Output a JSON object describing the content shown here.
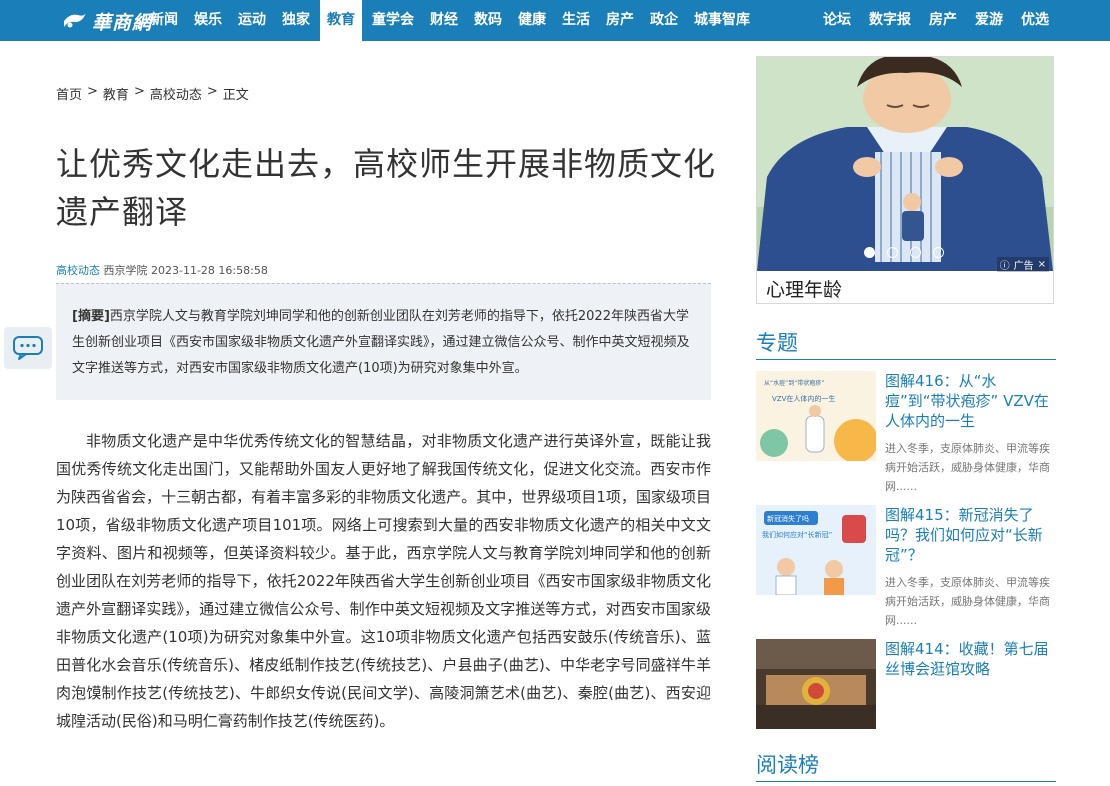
{
  "nav": {
    "logo_text": "華商網",
    "items": [
      "新闻",
      "娱乐",
      "运动",
      "独家",
      "教育",
      "童学会",
      "财经",
      "数码",
      "健康",
      "生活",
      "房产",
      "政企",
      "城事智库"
    ],
    "active": "教育",
    "right_items": [
      "论坛",
      "数字报",
      "房产",
      "爱游",
      "优选"
    ]
  },
  "breadcrumb": [
    "首页",
    "教育",
    "高校动态",
    "正文"
  ],
  "breadcrumb_sep": ">",
  "article": {
    "title": "让优秀文化走出去，高校师生开展非物质文化遗产翻译",
    "category": "高校动态",
    "source": "西京学院",
    "datetime": "2023-11-28 16:58:58",
    "abstract_label": "[摘要]",
    "abstract_text": "西京学院人文与教育学院刘坤同学和他的创新创业团队在刘芳老师的指导下，依托2022年陕西省大学生创新创业项目《西安市国家级非物质文化遗产外宣翻译实践》，通过建立微信公众号、制作中英文短视频及文字推送等方式，对西安市国家级非物质文化遗产(10项)为研究对象集中外宣。",
    "body": "非物质文化遗产是中华优秀传统文化的智慧结晶，对非物质文化遗产进行英译外宣，既能让我国优秀传统文化走出国门，又能帮助外国友人更好地了解我国传统文化，促进文化交流。西安市作为陕西省省会，十三朝古都，有着丰富多彩的非物质文化遗产。其中，世界级项目1项，国家级项目10项，省级非物质文化遗产项目101项。网络上可搜索到大量的西安非物质文化遗产的相关中文文字资料、图片和视频等，但英译资料较少。基于此，西京学院人文与教育学院刘坤同学和他的创新创业团队在刘芳老师的指导下，依托2022年陕西省大学生创新创业项目《西安市国家级非物质文化遗产外宣翻译实践》，通过建立微信公众号、制作中英文短视频及文字推送等方式，对西安市国家级非物质文化遗产(10项)为研究对象集中外宣。这10项非物质文化遗产包括西安鼓乐(传统音乐)、蓝田普化水会音乐(传统音乐)、楮皮纸制作技艺(传统技艺)、户县曲子(曲艺)、中华老字号同盛祥牛羊肉泡馍制作技艺(传统技艺)、牛郎织女传说(民间文学)、高陵洞箫艺术(曲艺)、秦腔(曲艺)、西安迎城隍活动(民俗)和马明仁膏药制作技艺(传统医药)。"
  },
  "ad": {
    "caption": "心理年龄",
    "tag": "广告",
    "dots_total": 4,
    "dots_active": 1
  },
  "special": {
    "heading": "专题",
    "topics": [
      {
        "title": "图解416：从“水痘”到“带状疱疹” VZV在人体内的一生",
        "desc": "进入冬季，支原体肺炎、甲流等疾病开始活跃，威胁身体健康，华商网......",
        "thumb_lines": [
          "从“水痘”到“带状疱疹”",
          "VZV在人体内的一生"
        ]
      },
      {
        "title": "图解415：新冠消失了吗？我们如何应对“长新冠”？",
        "desc": "进入冬季，支原体肺炎、甲流等疾病开始活跃，威胁身体健康，华商网......",
        "thumb_lines": [
          "新冠消失了吗",
          "我们如何应对“长新冠”"
        ]
      },
      {
        "title": "图解414：收藏！第七届丝博会逛馆攻略",
        "desc": ""
      }
    ]
  },
  "ranking": {
    "heading": "阅读榜"
  },
  "colors": {
    "brand": "#1a7fb8",
    "abstract_bg": "#eef2f6"
  }
}
